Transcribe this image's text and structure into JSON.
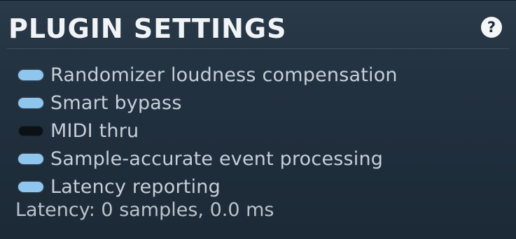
{
  "header": {
    "title": "PLUGIN SETTINGS",
    "help_glyph": "?",
    "help_icon": "question-circle-icon"
  },
  "options": [
    {
      "label": "Randomizer loudness compensation",
      "enabled": true
    },
    {
      "label": "Smart bypass",
      "enabled": true
    },
    {
      "label": "MIDI thru",
      "enabled": false
    },
    {
      "label": "Sample-accurate event processing",
      "enabled": true
    },
    {
      "label": "Latency reporting",
      "enabled": true
    }
  ],
  "status": {
    "latency_text": "Latency: 0 samples, 0.0 ms"
  },
  "colors": {
    "toggle_on": "#8fc6ee",
    "toggle_off": "#0c1116",
    "background": "#223140",
    "title": "#f1f4f7"
  }
}
